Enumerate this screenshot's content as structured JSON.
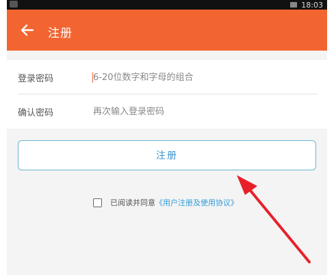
{
  "status": {
    "time": "18:03"
  },
  "appbar": {
    "title": "注册",
    "back_icon": "arrow-left-icon"
  },
  "form": {
    "password_label": "登录密码",
    "password_placeholder": "6-20位数字和字母的组合",
    "confirm_label": "确认密码",
    "confirm_placeholder": "再次输入登录密码"
  },
  "register_button": {
    "label": "注册"
  },
  "agreement": {
    "prefix": "已阅读并同意",
    "link": "《用户注册及使用协议》"
  },
  "annotation": {
    "icon": "red-arrow-icon",
    "color": "#e8202a"
  },
  "colors": {
    "accent": "#f26531",
    "button_border": "#6bb4d6",
    "link": "#2f9bd7"
  }
}
